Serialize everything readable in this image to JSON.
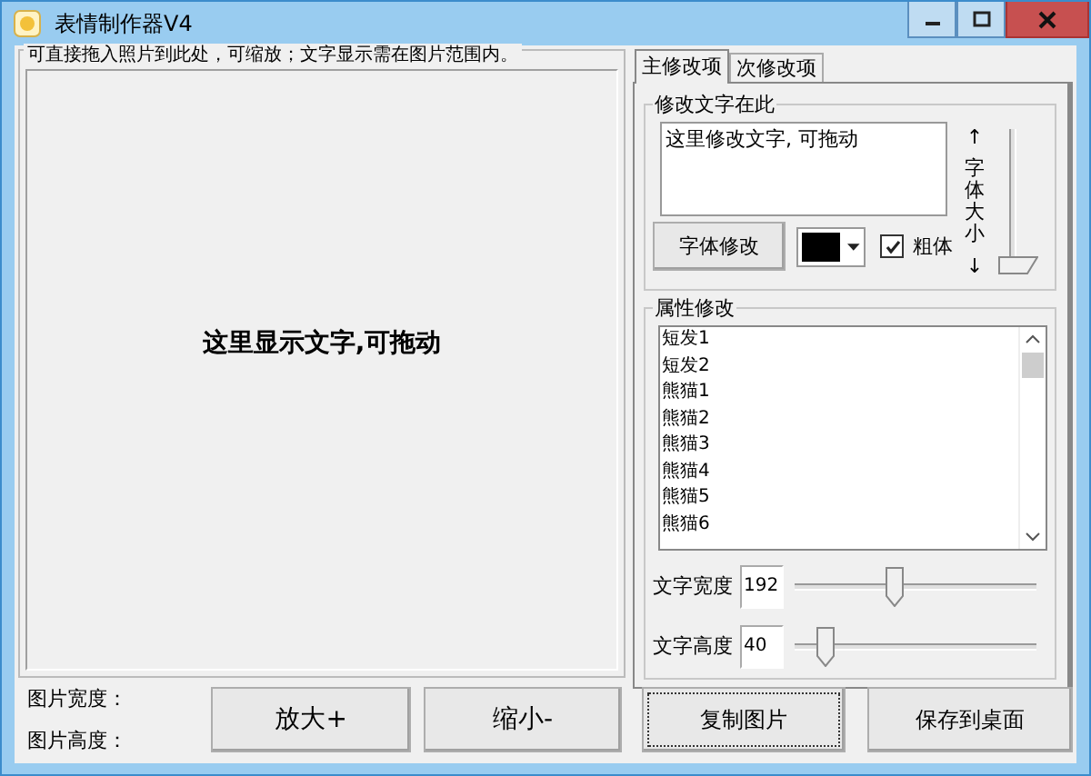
{
  "window": {
    "title": "表情制作器V4"
  },
  "canvas": {
    "caption": "可直接拖入照片到此处，可缩放；文字显示需在图片范围内。",
    "overlay_text": "这里显示文字,可拖动"
  },
  "tabs": [
    {
      "label": "主修改项",
      "selected": true
    },
    {
      "label": "次修改项",
      "selected": false
    }
  ],
  "text_group": {
    "caption": "修改文字在此",
    "text": "这里修改文字, 可拖动",
    "font_button": "字体修改",
    "color": "#000000",
    "bold_label": "粗体",
    "bold_checked": true,
    "size_up": "↑",
    "size_label": "字体大小",
    "size_down": "↓",
    "size_slider": {
      "level": 0
    }
  },
  "attr_group": {
    "caption": "属性修改",
    "items": [
      {
        "label": "短发1",
        "selected": false
      },
      {
        "label": "短发2",
        "selected": false
      },
      {
        "label": "熊猫1",
        "selected": false
      },
      {
        "label": "熊猫2",
        "selected": false
      },
      {
        "label": "熊猫3",
        "selected": false
      },
      {
        "label": "熊猫4",
        "selected": false
      },
      {
        "label": "熊猫5",
        "selected": false
      },
      {
        "label": "熊猫6",
        "selected": false
      }
    ],
    "sliders": [
      {
        "label": "文字宽度",
        "value": "192",
        "level": 0.41
      },
      {
        "label": "文字高度",
        "value": "40",
        "level": 0.13
      }
    ]
  },
  "info": [
    "图片宽度：",
    "图片高度："
  ],
  "buttons": [
    {
      "label": "放大+",
      "focused": false
    },
    {
      "label": "缩小-",
      "focused": false
    },
    {
      "label": "复制图片",
      "focused": true
    },
    {
      "label": "保存到桌面",
      "focused": false
    }
  ]
}
